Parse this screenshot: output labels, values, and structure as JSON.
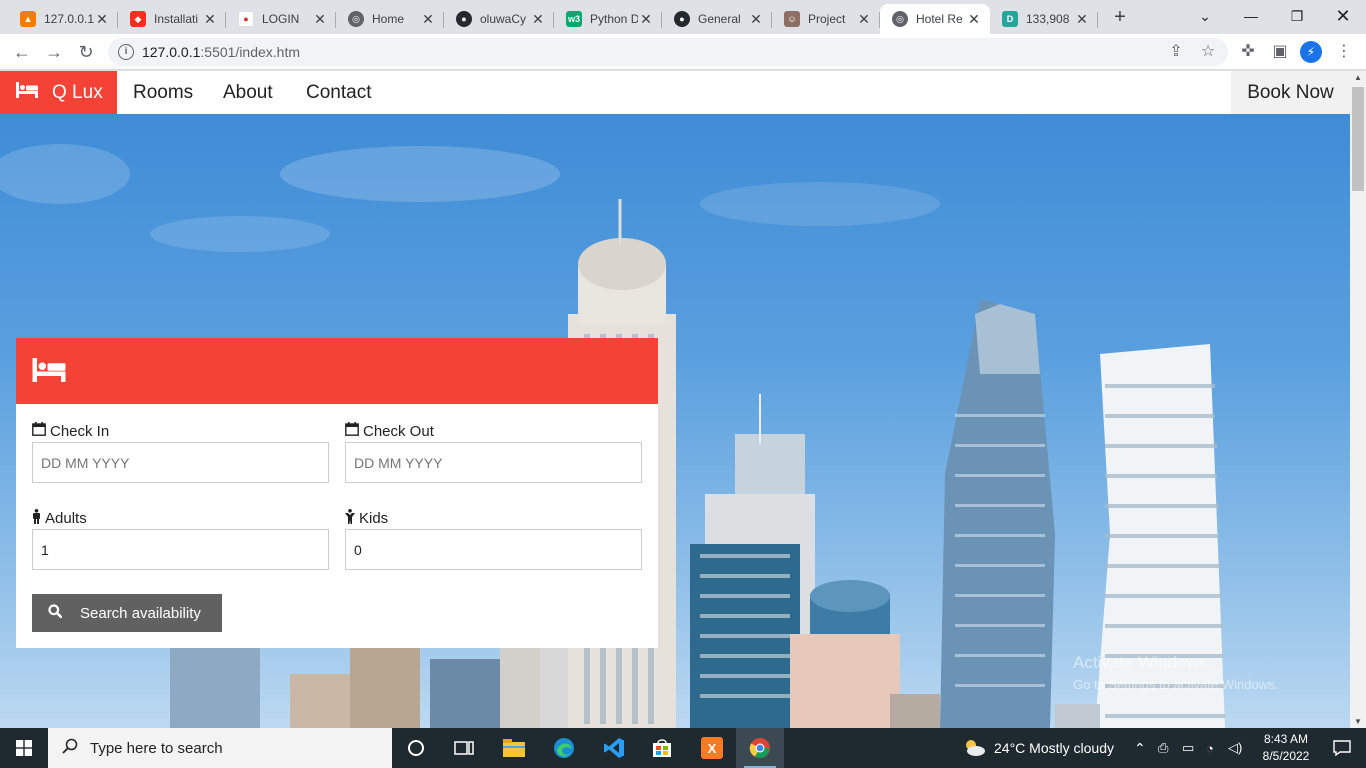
{
  "browser": {
    "tabs": [
      {
        "title": "127.0.0.1",
        "favicon": "xampp-icon",
        "color": "#f57c00"
      },
      {
        "title": "Installati",
        "favicon": "laravel-icon",
        "color": "#ff2d20"
      },
      {
        "title": "LOGIN",
        "favicon": "login-icon",
        "color": "#d32f2f"
      },
      {
        "title": "Home",
        "favicon": "globe-icon",
        "color": "#5f6368"
      },
      {
        "title": "oluwaCy",
        "favicon": "github-icon",
        "color": "#24292e"
      },
      {
        "title": "Python D",
        "favicon": "w3schools-icon",
        "color": "#04aa6d"
      },
      {
        "title": "General",
        "favicon": "github-icon",
        "color": "#24292e"
      },
      {
        "title": "Project",
        "favicon": "profile-photo-icon",
        "color": "#8d6e63"
      },
      {
        "title": "Hotel Re",
        "favicon": "globe-icon",
        "color": "#5f6368"
      },
      {
        "title": "133,908",
        "favicon": "d-icon",
        "color": "#26a69a"
      }
    ],
    "active_tab_index": 8,
    "url_host": "127.0.0.1",
    "url_path": ":5501/index.htm"
  },
  "site": {
    "brand": "Q Lux",
    "nav": [
      "Rooms",
      "About",
      "Contact"
    ],
    "cta": "Book Now",
    "accent_color": "#f44336",
    "booking": {
      "check_in_label": "Check In",
      "check_in_placeholder": "DD MM YYYY",
      "check_out_label": "Check Out",
      "check_out_placeholder": "DD MM YYYY",
      "adults_label": "Adults",
      "adults_value": "1",
      "kids_label": "Kids",
      "kids_value": "0",
      "search_label": "Search availability"
    }
  },
  "watermark": {
    "line1": "Activate Windows",
    "line2": "Go to Settings to activate Windows."
  },
  "taskbar": {
    "search_placeholder": "Type here to search",
    "weather": "24°C  Mostly cloudy",
    "time": "8:43 AM",
    "date": "8/5/2022"
  }
}
